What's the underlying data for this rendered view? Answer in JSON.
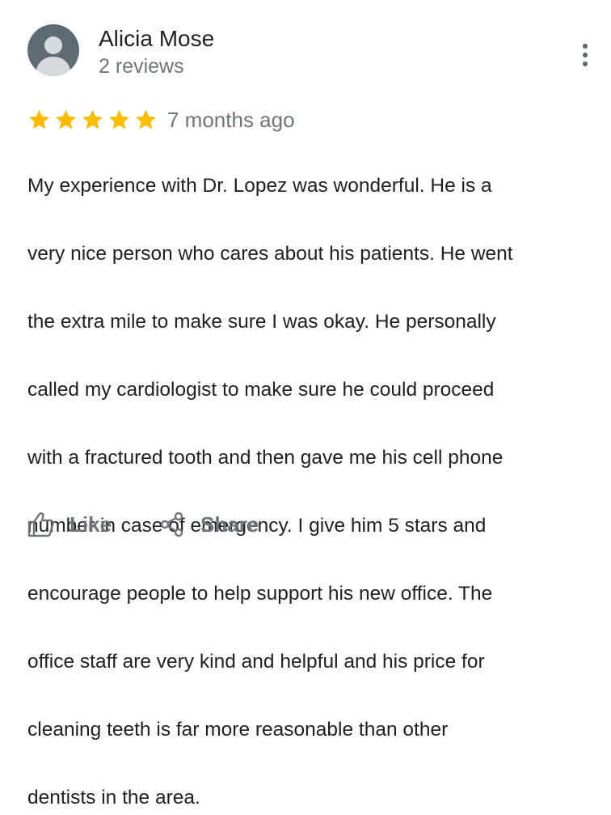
{
  "review": {
    "reviewer_name": "Alicia Mose",
    "reviewer_reviews": "2 reviews",
    "rating": 5,
    "rating_max": 5,
    "date": "7 months ago",
    "text_lines": [
      "My experience with Dr. Lopez was wonderful. He is a",
      "very nice person who cares about his patients. He went",
      "the extra mile to make sure I was okay. He personally",
      "called my cardiologist to make sure he could proceed",
      "with a fractured tooth and then gave me his cell phone",
      "number in case of emergency. I give him 5 stars and",
      "encourage people to help support his new office.  The",
      "office staff are very kind and helpful and his price for",
      "cleaning teeth is far more reasonable than other",
      "dentists in the area."
    ]
  },
  "actions": {
    "like_label": "Like",
    "share_label": "Share"
  },
  "icons": {
    "avatar": "person-avatar-icon",
    "more": "more-vert-icon",
    "star": "star-icon",
    "like": "thumb-up-icon",
    "share": "share-icon"
  },
  "colors": {
    "star": "#fbbc04",
    "text": "#202124",
    "secondary_text": "#70757a",
    "avatar_bg": "#5f6b73",
    "avatar_figure": "#d7dadd"
  }
}
